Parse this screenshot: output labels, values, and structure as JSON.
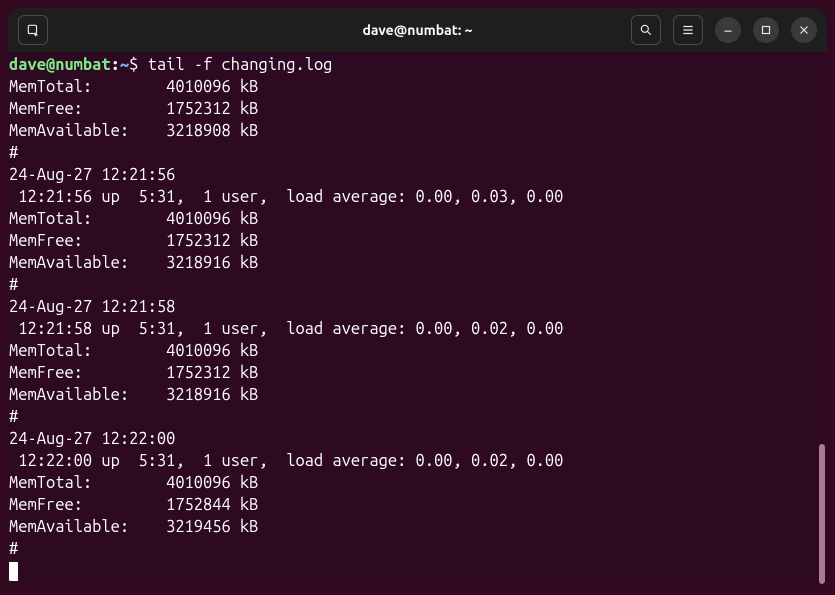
{
  "titlebar": {
    "title": "dave@numbat: ~"
  },
  "prompt": {
    "userhost": "dave@numbat",
    "colon": ":",
    "path": "~",
    "dollar": "$ ",
    "command": "tail -f changing.log"
  },
  "output": [
    "MemTotal:        4010096 kB",
    "MemFree:         1752312 kB",
    "MemAvailable:    3218908 kB",
    "#",
    "24-Aug-27 12:21:56",
    " 12:21:56 up  5:31,  1 user,  load average: 0.00, 0.03, 0.00",
    "MemTotal:        4010096 kB",
    "MemFree:         1752312 kB",
    "MemAvailable:    3218916 kB",
    "#",
    "24-Aug-27 12:21:58",
    " 12:21:58 up  5:31,  1 user,  load average: 0.00, 0.02, 0.00",
    "MemTotal:        4010096 kB",
    "MemFree:         1752312 kB",
    "MemAvailable:    3218916 kB",
    "#",
    "24-Aug-27 12:22:00",
    " 12:22:00 up  5:31,  1 user,  load average: 0.00, 0.02, 0.00",
    "MemTotal:        4010096 kB",
    "MemFree:         1752844 kB",
    "MemAvailable:    3219456 kB",
    "#"
  ]
}
